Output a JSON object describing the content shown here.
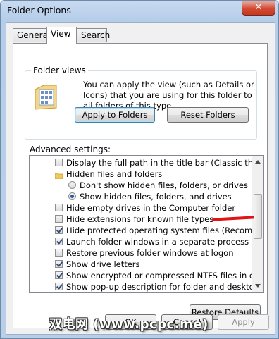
{
  "window": {
    "title": "Folder Options",
    "close_glyph": "✕"
  },
  "tabs": [
    {
      "label": "General",
      "active": false
    },
    {
      "label": "View",
      "active": true
    },
    {
      "label": "Search",
      "active": false
    }
  ],
  "folder_views": {
    "label": "Folder views",
    "description": "You can apply the view (such as Details or Icons) that you are using for this folder to all folders of this type.",
    "icon": "folder-views-icon",
    "apply_button": "Apply to Folders",
    "reset_button": "Reset Folders"
  },
  "advanced": {
    "label": "Advanced settings:",
    "items": [
      {
        "type": "checkbox",
        "checked": false,
        "indent": 1,
        "label": "Display the full path in the title bar (Classic theme only)"
      },
      {
        "type": "folder",
        "indent": 1,
        "label": "Hidden files and folders",
        "icon": "folder-icon"
      },
      {
        "type": "radio",
        "checked": false,
        "indent": 2,
        "label": "Don't show hidden files, folders, or drives"
      },
      {
        "type": "radio",
        "checked": true,
        "indent": 2,
        "label": "Show hidden files, folders, and drives"
      },
      {
        "type": "checkbox",
        "checked": false,
        "indent": 1,
        "label": "Hide empty drives in the Computer folder"
      },
      {
        "type": "checkbox",
        "checked": false,
        "indent": 1,
        "label": "Hide extensions for known file types"
      },
      {
        "type": "checkbox",
        "checked": true,
        "indent": 1,
        "label": "Hide protected operating system files (Recommended)"
      },
      {
        "type": "checkbox",
        "checked": true,
        "indent": 1,
        "label": "Launch folder windows in a separate process"
      },
      {
        "type": "checkbox",
        "checked": false,
        "indent": 1,
        "label": "Restore previous folder windows at logon"
      },
      {
        "type": "checkbox",
        "checked": true,
        "indent": 1,
        "label": "Show drive letters"
      },
      {
        "type": "checkbox",
        "checked": true,
        "indent": 1,
        "label": "Show encrypted or compressed NTFS files in color"
      },
      {
        "type": "checkbox",
        "checked": true,
        "indent": 1,
        "label": "Show pop-up description for folder and desktop items"
      }
    ],
    "restore_defaults": "Restore Defaults"
  },
  "footer": {
    "ok": "OK",
    "cancel": "Cancel",
    "apply": "Apply"
  },
  "watermark": "双电网 (www.pcpc.me)",
  "colors": {
    "accent": "#3c7fb1",
    "close": "#c7391f",
    "annotation": "#e01414"
  }
}
